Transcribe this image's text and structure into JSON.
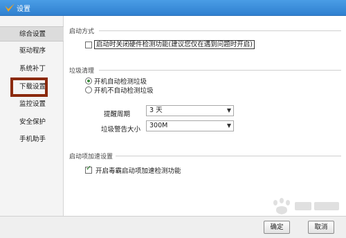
{
  "window": {
    "title": "设置"
  },
  "sidebar": {
    "items": [
      {
        "label": "综合设置"
      },
      {
        "label": "驱动程序"
      },
      {
        "label": "系统补丁"
      },
      {
        "label": "下载设置"
      },
      {
        "label": "监控设置"
      },
      {
        "label": "安全保护"
      },
      {
        "label": "手机助手"
      }
    ]
  },
  "startup": {
    "title": "启动方式",
    "option_label": "启动时关闭硬件检测功能(建议您仅在遇到问题时开启)",
    "checked": false
  },
  "cleanup": {
    "title": "垃圾清理",
    "options": [
      {
        "label": "开机自动检测垃圾",
        "checked": true
      },
      {
        "label": "开机不自动检测垃圾",
        "checked": false
      }
    ],
    "reminder_label": "提醒周期",
    "reminder_value": "3 天",
    "warning_label": "垃圾警告大小",
    "warning_value": "300M"
  },
  "acceleration": {
    "title": "启动项加速设置",
    "option_label": "开启毒霸启动项加速检测功能",
    "checked": true
  },
  "footer": {
    "ok_label": "确定",
    "cancel_label": "取消"
  },
  "colors": {
    "titlebar": "#2f80d0",
    "highlight": "#8b2a0e",
    "check": "#1f7a1f"
  }
}
